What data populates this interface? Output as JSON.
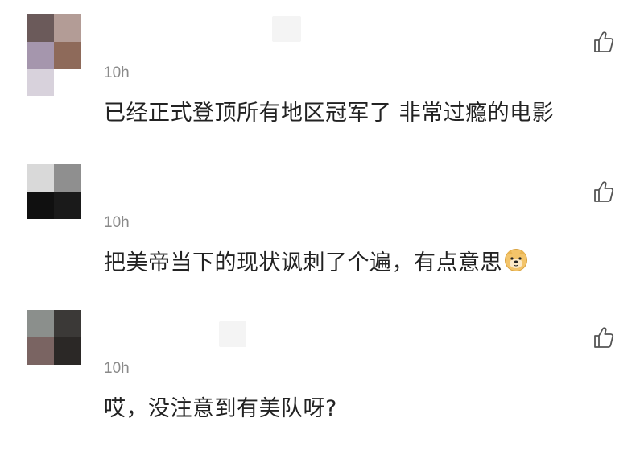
{
  "comments": [
    {
      "time": "10h",
      "text": "已经正式登顶所有地区冠军了 非常过瘾的电影",
      "avatar_colors": [
        "#6b5a5a",
        "#b39c96",
        "#a596ad",
        "#8e6a5a",
        "#d8d2dc",
        "#ffffff"
      ]
    },
    {
      "time": "10h",
      "text": "把美帝当下的现状讽刺了个遍，有点意思",
      "emoji": "doge-emoji",
      "avatar_colors": [
        "#d9d9d9",
        "#8f8f8f",
        "#101010",
        "#1a1a1a",
        "#ffffff",
        "#ffffff"
      ]
    },
    {
      "time": "10h",
      "text": "哎，没注意到有美队呀?",
      "avatar_colors": [
        "#8b8f8c",
        "#3b3937",
        "#7a6462",
        "#2b2826",
        "#ffffff",
        "#ffffff"
      ]
    }
  ],
  "icons": {
    "like": "thumbs-up-icon"
  },
  "colors": {
    "text": "#222222",
    "time": "#8a8a8a",
    "icon": "#555555"
  }
}
